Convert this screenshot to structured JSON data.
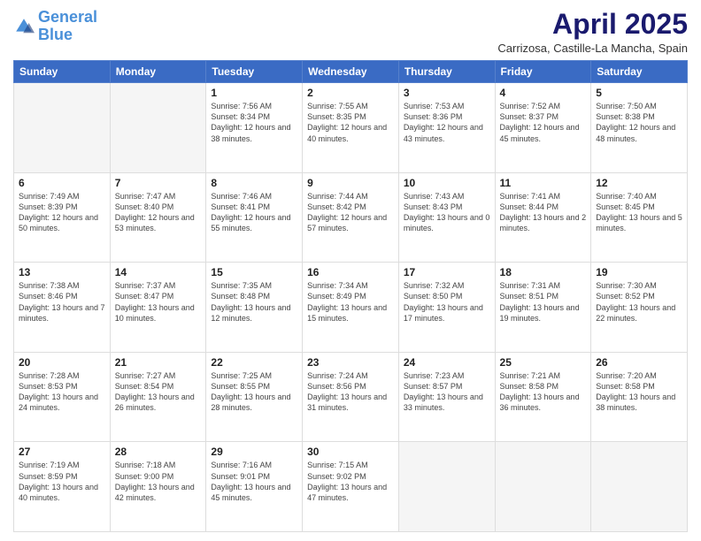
{
  "header": {
    "logo_general": "General",
    "logo_blue": "Blue",
    "month_title": "April 2025",
    "subtitle": "Carrizosa, Castille-La Mancha, Spain"
  },
  "weekdays": [
    "Sunday",
    "Monday",
    "Tuesday",
    "Wednesday",
    "Thursday",
    "Friday",
    "Saturday"
  ],
  "weeks": [
    [
      {
        "day": "",
        "sunrise": "",
        "sunset": "",
        "daylight": ""
      },
      {
        "day": "",
        "sunrise": "",
        "sunset": "",
        "daylight": ""
      },
      {
        "day": "1",
        "sunrise": "Sunrise: 7:56 AM",
        "sunset": "Sunset: 8:34 PM",
        "daylight": "Daylight: 12 hours and 38 minutes."
      },
      {
        "day": "2",
        "sunrise": "Sunrise: 7:55 AM",
        "sunset": "Sunset: 8:35 PM",
        "daylight": "Daylight: 12 hours and 40 minutes."
      },
      {
        "day": "3",
        "sunrise": "Sunrise: 7:53 AM",
        "sunset": "Sunset: 8:36 PM",
        "daylight": "Daylight: 12 hours and 43 minutes."
      },
      {
        "day": "4",
        "sunrise": "Sunrise: 7:52 AM",
        "sunset": "Sunset: 8:37 PM",
        "daylight": "Daylight: 12 hours and 45 minutes."
      },
      {
        "day": "5",
        "sunrise": "Sunrise: 7:50 AM",
        "sunset": "Sunset: 8:38 PM",
        "daylight": "Daylight: 12 hours and 48 minutes."
      }
    ],
    [
      {
        "day": "6",
        "sunrise": "Sunrise: 7:49 AM",
        "sunset": "Sunset: 8:39 PM",
        "daylight": "Daylight: 12 hours and 50 minutes."
      },
      {
        "day": "7",
        "sunrise": "Sunrise: 7:47 AM",
        "sunset": "Sunset: 8:40 PM",
        "daylight": "Daylight: 12 hours and 53 minutes."
      },
      {
        "day": "8",
        "sunrise": "Sunrise: 7:46 AM",
        "sunset": "Sunset: 8:41 PM",
        "daylight": "Daylight: 12 hours and 55 minutes."
      },
      {
        "day": "9",
        "sunrise": "Sunrise: 7:44 AM",
        "sunset": "Sunset: 8:42 PM",
        "daylight": "Daylight: 12 hours and 57 minutes."
      },
      {
        "day": "10",
        "sunrise": "Sunrise: 7:43 AM",
        "sunset": "Sunset: 8:43 PM",
        "daylight": "Daylight: 13 hours and 0 minutes."
      },
      {
        "day": "11",
        "sunrise": "Sunrise: 7:41 AM",
        "sunset": "Sunset: 8:44 PM",
        "daylight": "Daylight: 13 hours and 2 minutes."
      },
      {
        "day": "12",
        "sunrise": "Sunrise: 7:40 AM",
        "sunset": "Sunset: 8:45 PM",
        "daylight": "Daylight: 13 hours and 5 minutes."
      }
    ],
    [
      {
        "day": "13",
        "sunrise": "Sunrise: 7:38 AM",
        "sunset": "Sunset: 8:46 PM",
        "daylight": "Daylight: 13 hours and 7 minutes."
      },
      {
        "day": "14",
        "sunrise": "Sunrise: 7:37 AM",
        "sunset": "Sunset: 8:47 PM",
        "daylight": "Daylight: 13 hours and 10 minutes."
      },
      {
        "day": "15",
        "sunrise": "Sunrise: 7:35 AM",
        "sunset": "Sunset: 8:48 PM",
        "daylight": "Daylight: 13 hours and 12 minutes."
      },
      {
        "day": "16",
        "sunrise": "Sunrise: 7:34 AM",
        "sunset": "Sunset: 8:49 PM",
        "daylight": "Daylight: 13 hours and 15 minutes."
      },
      {
        "day": "17",
        "sunrise": "Sunrise: 7:32 AM",
        "sunset": "Sunset: 8:50 PM",
        "daylight": "Daylight: 13 hours and 17 minutes."
      },
      {
        "day": "18",
        "sunrise": "Sunrise: 7:31 AM",
        "sunset": "Sunset: 8:51 PM",
        "daylight": "Daylight: 13 hours and 19 minutes."
      },
      {
        "day": "19",
        "sunrise": "Sunrise: 7:30 AM",
        "sunset": "Sunset: 8:52 PM",
        "daylight": "Daylight: 13 hours and 22 minutes."
      }
    ],
    [
      {
        "day": "20",
        "sunrise": "Sunrise: 7:28 AM",
        "sunset": "Sunset: 8:53 PM",
        "daylight": "Daylight: 13 hours and 24 minutes."
      },
      {
        "day": "21",
        "sunrise": "Sunrise: 7:27 AM",
        "sunset": "Sunset: 8:54 PM",
        "daylight": "Daylight: 13 hours and 26 minutes."
      },
      {
        "day": "22",
        "sunrise": "Sunrise: 7:25 AM",
        "sunset": "Sunset: 8:55 PM",
        "daylight": "Daylight: 13 hours and 28 minutes."
      },
      {
        "day": "23",
        "sunrise": "Sunrise: 7:24 AM",
        "sunset": "Sunset: 8:56 PM",
        "daylight": "Daylight: 13 hours and 31 minutes."
      },
      {
        "day": "24",
        "sunrise": "Sunrise: 7:23 AM",
        "sunset": "Sunset: 8:57 PM",
        "daylight": "Daylight: 13 hours and 33 minutes."
      },
      {
        "day": "25",
        "sunrise": "Sunrise: 7:21 AM",
        "sunset": "Sunset: 8:58 PM",
        "daylight": "Daylight: 13 hours and 36 minutes."
      },
      {
        "day": "26",
        "sunrise": "Sunrise: 7:20 AM",
        "sunset": "Sunset: 8:58 PM",
        "daylight": "Daylight: 13 hours and 38 minutes."
      }
    ],
    [
      {
        "day": "27",
        "sunrise": "Sunrise: 7:19 AM",
        "sunset": "Sunset: 8:59 PM",
        "daylight": "Daylight: 13 hours and 40 minutes."
      },
      {
        "day": "28",
        "sunrise": "Sunrise: 7:18 AM",
        "sunset": "Sunset: 9:00 PM",
        "daylight": "Daylight: 13 hours and 42 minutes."
      },
      {
        "day": "29",
        "sunrise": "Sunrise: 7:16 AM",
        "sunset": "Sunset: 9:01 PM",
        "daylight": "Daylight: 13 hours and 45 minutes."
      },
      {
        "day": "30",
        "sunrise": "Sunrise: 7:15 AM",
        "sunset": "Sunset: 9:02 PM",
        "daylight": "Daylight: 13 hours and 47 minutes."
      },
      {
        "day": "",
        "sunrise": "",
        "sunset": "",
        "daylight": ""
      },
      {
        "day": "",
        "sunrise": "",
        "sunset": "",
        "daylight": ""
      },
      {
        "day": "",
        "sunrise": "",
        "sunset": "",
        "daylight": ""
      }
    ]
  ]
}
